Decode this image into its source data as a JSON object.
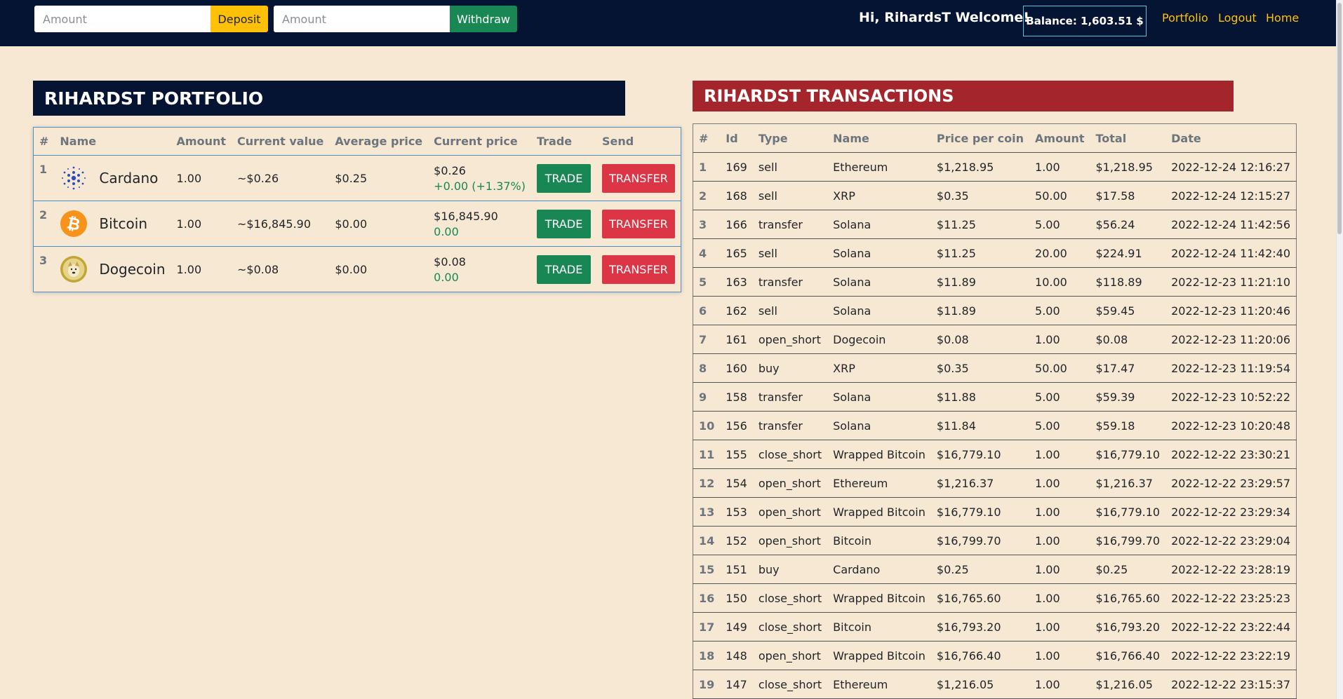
{
  "topbar": {
    "deposit_placeholder": "Amount",
    "deposit_label": "Deposit",
    "withdraw_placeholder": "Amount",
    "withdraw_label": "Withdraw",
    "welcome": "Hi, RihardsT Welcome!",
    "balance": "Balance: 1,603.51 $",
    "nav": {
      "portfolio": "Portfolio",
      "logout": "Logout",
      "home": "Home"
    }
  },
  "portfolio": {
    "title": "RIHARDST PORTFOLIO",
    "columns": [
      "#",
      "Name",
      "Amount",
      "Current value",
      "Average price",
      "Current price",
      "Trade",
      "Send"
    ],
    "rows": [
      {
        "idx": "1",
        "name": "Cardano",
        "icon": "cardano-icon",
        "amount": "1.00",
        "current_value": "~$0.26",
        "average_price": "$0.25",
        "current_price": "$0.26",
        "change": "+0.00 (+1.37%)",
        "trade": "TRADE",
        "send": "TRANSFER"
      },
      {
        "idx": "2",
        "name": "Bitcoin",
        "icon": "bitcoin-icon",
        "amount": "1.00",
        "current_value": "~$16,845.90",
        "average_price": "$0.00",
        "current_price": "$16,845.90",
        "change": "0.00",
        "trade": "TRADE",
        "send": "TRANSFER"
      },
      {
        "idx": "3",
        "name": "Dogecoin",
        "icon": "dogecoin-icon",
        "amount": "1.00",
        "current_value": "~$0.08",
        "average_price": "$0.00",
        "current_price": "$0.08",
        "change": "0.00",
        "trade": "TRADE",
        "send": "TRANSFER"
      }
    ]
  },
  "transactions": {
    "title": "RIHARDST TRANSACTIONS",
    "columns": [
      "#",
      "Id",
      "Type",
      "Name",
      "Price per coin",
      "Amount",
      "Total",
      "Date"
    ],
    "rows": [
      [
        "1",
        "169",
        "sell",
        "Ethereum",
        "$1,218.95",
        "1.00",
        "$1,218.95",
        "2022-12-24 12:16:27"
      ],
      [
        "2",
        "168",
        "sell",
        "XRP",
        "$0.35",
        "50.00",
        "$17.58",
        "2022-12-24 12:15:27"
      ],
      [
        "3",
        "166",
        "transfer",
        "Solana",
        "$11.25",
        "5.00",
        "$56.24",
        "2022-12-24 11:42:56"
      ],
      [
        "4",
        "165",
        "sell",
        "Solana",
        "$11.25",
        "20.00",
        "$224.91",
        "2022-12-24 11:42:40"
      ],
      [
        "5",
        "163",
        "transfer",
        "Solana",
        "$11.89",
        "10.00",
        "$118.89",
        "2022-12-23 11:21:10"
      ],
      [
        "6",
        "162",
        "sell",
        "Solana",
        "$11.89",
        "5.00",
        "$59.45",
        "2022-12-23 11:20:46"
      ],
      [
        "7",
        "161",
        "open_short",
        "Dogecoin",
        "$0.08",
        "1.00",
        "$0.08",
        "2022-12-23 11:20:06"
      ],
      [
        "8",
        "160",
        "buy",
        "XRP",
        "$0.35",
        "50.00",
        "$17.47",
        "2022-12-23 11:19:54"
      ],
      [
        "9",
        "158",
        "transfer",
        "Solana",
        "$11.88",
        "5.00",
        "$59.39",
        "2022-12-23 10:52:22"
      ],
      [
        "10",
        "156",
        "transfer",
        "Solana",
        "$11.84",
        "5.00",
        "$59.18",
        "2022-12-23 10:20:48"
      ],
      [
        "11",
        "155",
        "close_short",
        "Wrapped Bitcoin",
        "$16,779.10",
        "1.00",
        "$16,779.10",
        "2022-12-22 23:30:21"
      ],
      [
        "12",
        "154",
        "open_short",
        "Ethereum",
        "$1,216.37",
        "1.00",
        "$1,216.37",
        "2022-12-22 23:29:57"
      ],
      [
        "13",
        "153",
        "open_short",
        "Wrapped Bitcoin",
        "$16,779.10",
        "1.00",
        "$16,779.10",
        "2022-12-22 23:29:34"
      ],
      [
        "14",
        "152",
        "open_short",
        "Bitcoin",
        "$16,799.70",
        "1.00",
        "$16,799.70",
        "2022-12-22 23:29:04"
      ],
      [
        "15",
        "151",
        "buy",
        "Cardano",
        "$0.25",
        "1.00",
        "$0.25",
        "2022-12-22 23:28:19"
      ],
      [
        "16",
        "150",
        "close_short",
        "Wrapped Bitcoin",
        "$16,765.60",
        "1.00",
        "$16,765.60",
        "2022-12-22 23:25:23"
      ],
      [
        "17",
        "149",
        "close_short",
        "Bitcoin",
        "$16,793.20",
        "1.00",
        "$16,793.20",
        "2022-12-22 23:22:44"
      ],
      [
        "18",
        "148",
        "open_short",
        "Wrapped Bitcoin",
        "$16,766.40",
        "1.00",
        "$16,766.40",
        "2022-12-22 23:22:19"
      ],
      [
        "19",
        "147",
        "close_short",
        "Ethereum",
        "$1,216.05",
        "1.00",
        "$1,216.05",
        "2022-12-22 23:15:37"
      ]
    ]
  },
  "colors": {
    "navbar": "#041432",
    "page_bg": "#f7e8d4",
    "transactions_header": "#a4262c",
    "accent_yellow": "#ffc107",
    "success_green": "#198754",
    "danger_red": "#dc3545"
  }
}
